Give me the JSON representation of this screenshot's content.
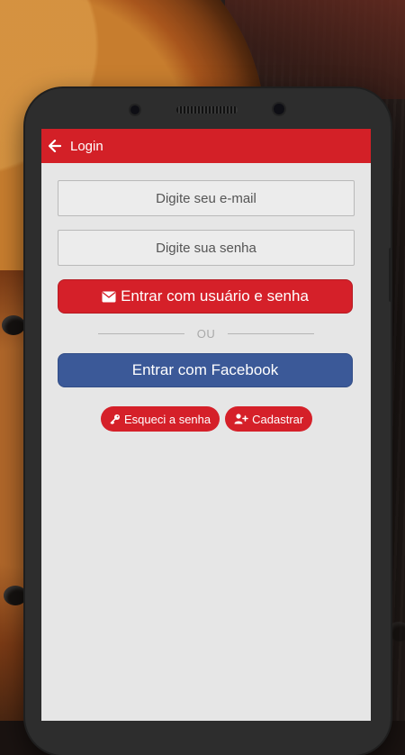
{
  "header": {
    "title": "Login",
    "back_icon": "arrow-left-icon"
  },
  "form": {
    "email_placeholder": "Digite seu e-mail",
    "password_placeholder": "Digite sua senha",
    "login_button": {
      "label": "Entrar com usuário e senha",
      "icon": "envelope-icon"
    },
    "divider_text": "OU",
    "facebook_button": {
      "label": "Entrar com Facebook"
    },
    "forgot_button": {
      "label": "Esqueci a senha",
      "icon": "key-icon"
    },
    "register_button": {
      "label": "Cadastrar",
      "icon": "user-plus-icon"
    }
  },
  "colors": {
    "primary_red": "#d32027",
    "facebook_blue": "#3b5998",
    "screen_bg": "#e6e6e6"
  }
}
